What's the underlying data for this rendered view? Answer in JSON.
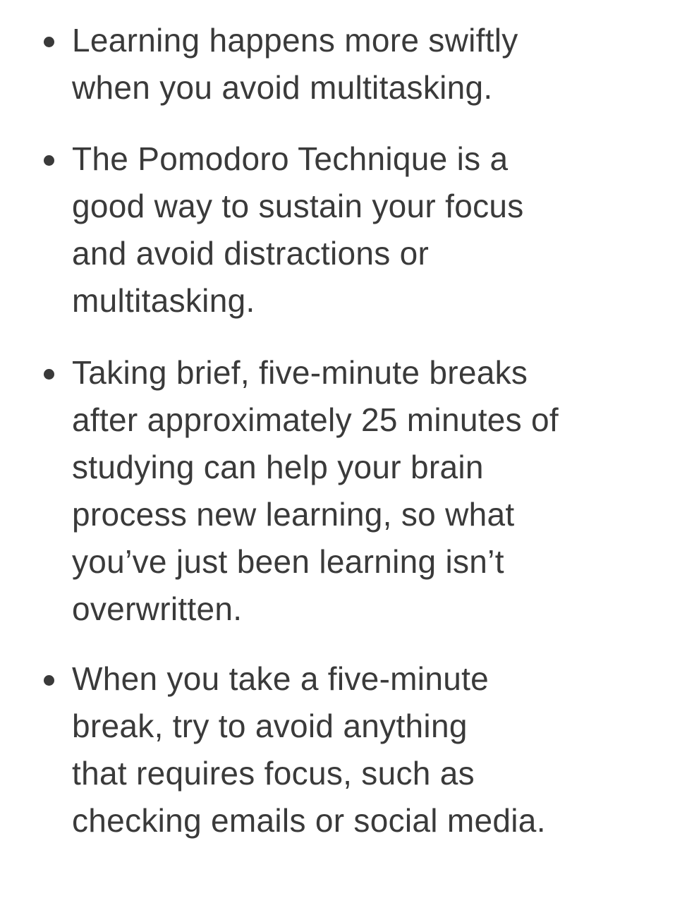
{
  "bullets": [
    {
      "lines": [
        "Learning happens more swiftly",
        "when you avoid multitasking."
      ]
    },
    {
      "lines": [
        "The Pomodoro Technique is a",
        "good way to sustain your focus",
        "and avoid distractions or",
        "multitasking."
      ]
    },
    {
      "lines": [
        "Taking brief, five-minute breaks",
        "after approximately 25 minutes of",
        "studying can help your brain",
        "process new learning, so what",
        "you’ve just been learning isn’t",
        "overwritten."
      ]
    },
    {
      "lines": [
        "When you take a five-minute",
        "break, try to avoid anything",
        "that requires focus, such as",
        "checking emails or social media."
      ]
    }
  ]
}
